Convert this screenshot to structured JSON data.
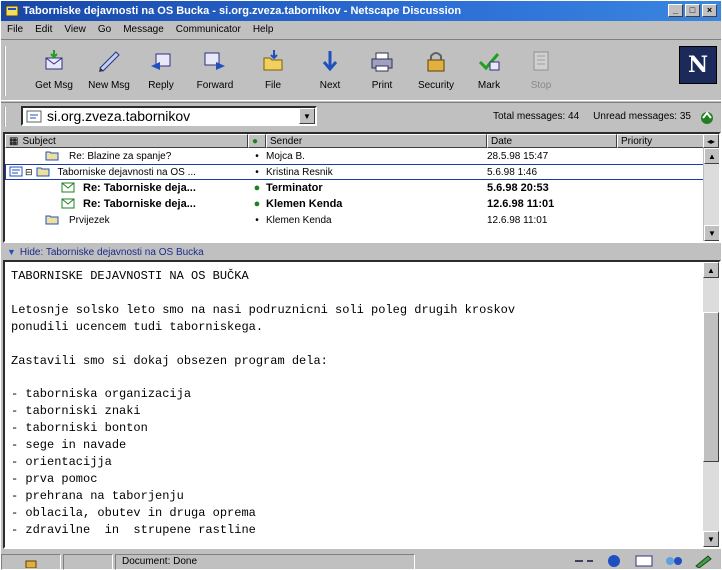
{
  "window": {
    "title": "Taborniske dejavnosti na OS Bucka - si.org.zveza.tabornikov - Netscape Discussion"
  },
  "menu": [
    "File",
    "Edit",
    "View",
    "Go",
    "Message",
    "Communicator",
    "Help"
  ],
  "toolbar": {
    "buttons": [
      {
        "label": "Get Msg",
        "icon": "get-msg-icon"
      },
      {
        "label": "New Msg",
        "icon": "new-msg-icon"
      },
      {
        "label": "Reply",
        "icon": "reply-icon"
      },
      {
        "label": "Forward",
        "icon": "forward-icon"
      },
      {
        "label": "File",
        "icon": "file-icon"
      },
      {
        "label": "Next",
        "icon": "next-icon"
      },
      {
        "label": "Print",
        "icon": "print-icon"
      },
      {
        "label": "Security",
        "icon": "security-icon"
      },
      {
        "label": "Mark",
        "icon": "mark-icon"
      },
      {
        "label": "Stop",
        "icon": "stop-icon",
        "disabled": true
      }
    ],
    "logo": "N"
  },
  "folderbar": {
    "folder": "si.org.zveza.tabornikov",
    "total": "Total messages: 44",
    "unread": "Unread messages: 35"
  },
  "list": {
    "columns": {
      "subject": "Subject",
      "sender": "Sender",
      "date": "Date",
      "priority": "Priority"
    },
    "rows": [
      {
        "subject": "Re: Blazine za spanje?",
        "sender": "Mojca B.",
        "date": "28.5.98 15:47",
        "bold": false,
        "level": 1
      },
      {
        "subject": "Taborniske dejavnosti na OS ...",
        "sender": "Kristina Resnik",
        "date": "5.6.98 1:46",
        "bold": false,
        "level": 0,
        "selected": true
      },
      {
        "subject": "Re: Taborniske deja...",
        "sender": "Terminator",
        "date": "5.6.98 20:53",
        "bold": true,
        "level": 2
      },
      {
        "subject": "Re: Taborniske deja...",
        "sender": "Klemen Kenda",
        "date": "12.6.98 11:01",
        "bold": true,
        "level": 2
      },
      {
        "subject": "Prvijezek",
        "sender": "Klemen Kenda",
        "date": "12.6.98 11:01",
        "bold": false,
        "level": 1
      }
    ]
  },
  "hidebar": "Hide: Taborniske dejavnosti na OS Bucka",
  "message_body": [
    "TABORNISKE DEJAVNOSTI NA OS BUČKA",
    "",
    "Letosnje solsko leto smo na nasi podruznicni soli poleg drugih kroskov",
    "ponudili ucencem tudi taborniskega.",
    "",
    "Zastavili smo si dokaj obsezen program dela:",
    "",
    "- taborniska organizacija",
    "- taborniski znaki",
    "- taborniski bonton",
    "- sege in navade",
    "- orientacijja",
    "- prva pomoc",
    "- prehrana na taborjenju",
    "- oblacila, obutev in druga oprema",
    "- zdravilne  in  strupene rastline"
  ],
  "status": "Document: Done"
}
